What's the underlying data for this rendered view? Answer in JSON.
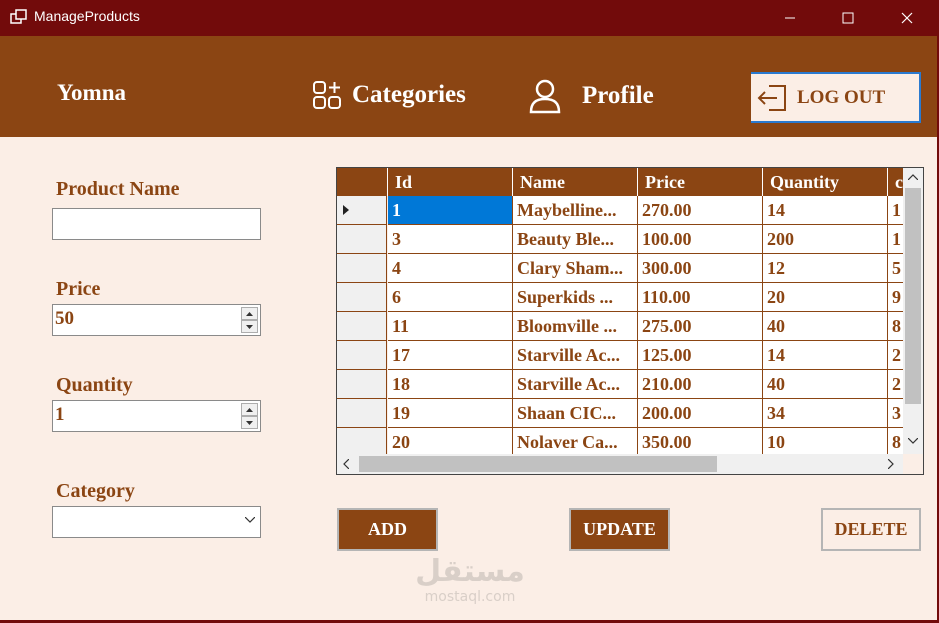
{
  "window": {
    "title": "ManageProducts"
  },
  "header": {
    "user_name": "Yomna",
    "nav_categories": "Categories",
    "nav_profile": "Profile",
    "logout_label": "LOG OUT"
  },
  "form": {
    "product_name_label": "Product Name",
    "product_name_value": "",
    "price_label": "Price",
    "price_value": "50",
    "quantity_label": "Quantity",
    "quantity_value": "1",
    "category_label": "Category",
    "category_value": ""
  },
  "table": {
    "columns": [
      "Id",
      "Name",
      "Price",
      "Quantity",
      "c"
    ],
    "rows": [
      [
        "1",
        "Maybelline...",
        "270.00",
        "14",
        "1"
      ],
      [
        "3",
        "Beauty Ble...",
        "100.00",
        "200",
        "1"
      ],
      [
        "4",
        "Clary Sham...",
        "300.00",
        "12",
        "5"
      ],
      [
        "6",
        "Superkids ...",
        "110.00",
        "20",
        "9"
      ],
      [
        "11",
        "Bloomville ...",
        "275.00",
        "40",
        "8"
      ],
      [
        "17",
        "Starville Ac...",
        "125.00",
        "14",
        "2"
      ],
      [
        "18",
        "Starville Ac...",
        "210.00",
        "40",
        "2"
      ],
      [
        "19",
        "Shaan CIC...",
        "200.00",
        "34",
        "3"
      ],
      [
        "20",
        "Nolaver Ca...",
        "350.00",
        "10",
        "8"
      ]
    ]
  },
  "buttons": {
    "add": "ADD",
    "update": "UPDATE",
    "delete": "DELETE"
  },
  "watermark": {
    "arabic": "مستقل",
    "latin": "mostaql.com"
  },
  "colors": {
    "titlebar": "#720b0b",
    "header": "#8b4513",
    "background": "#fbeee6",
    "selection": "#0078d7"
  }
}
